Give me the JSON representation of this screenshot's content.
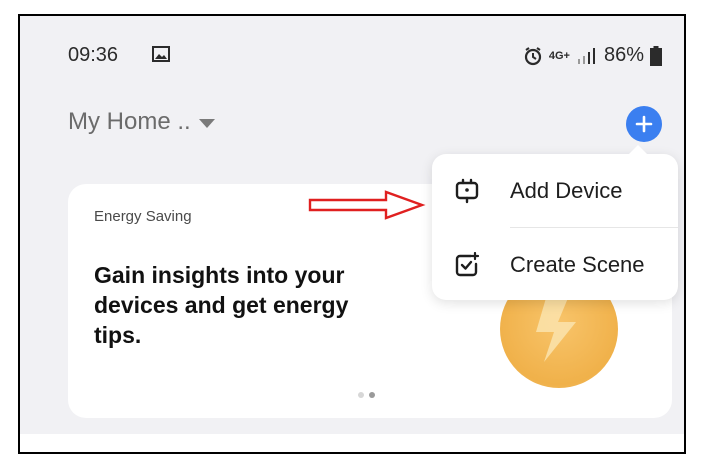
{
  "status_bar": {
    "time": "09:36",
    "network": "4G+",
    "battery": "86%"
  },
  "header": {
    "home_label": "My Home .."
  },
  "card": {
    "label": "Energy Saving",
    "headline": "Gain insights into your devices and get energy tips."
  },
  "menu": {
    "items": [
      {
        "label": "Add Device",
        "icon": "device-plug-icon"
      },
      {
        "label": "Create Scene",
        "icon": "scene-check-icon"
      }
    ]
  },
  "colors": {
    "accent": "#3b7ff0",
    "arrow": "#e02020"
  }
}
